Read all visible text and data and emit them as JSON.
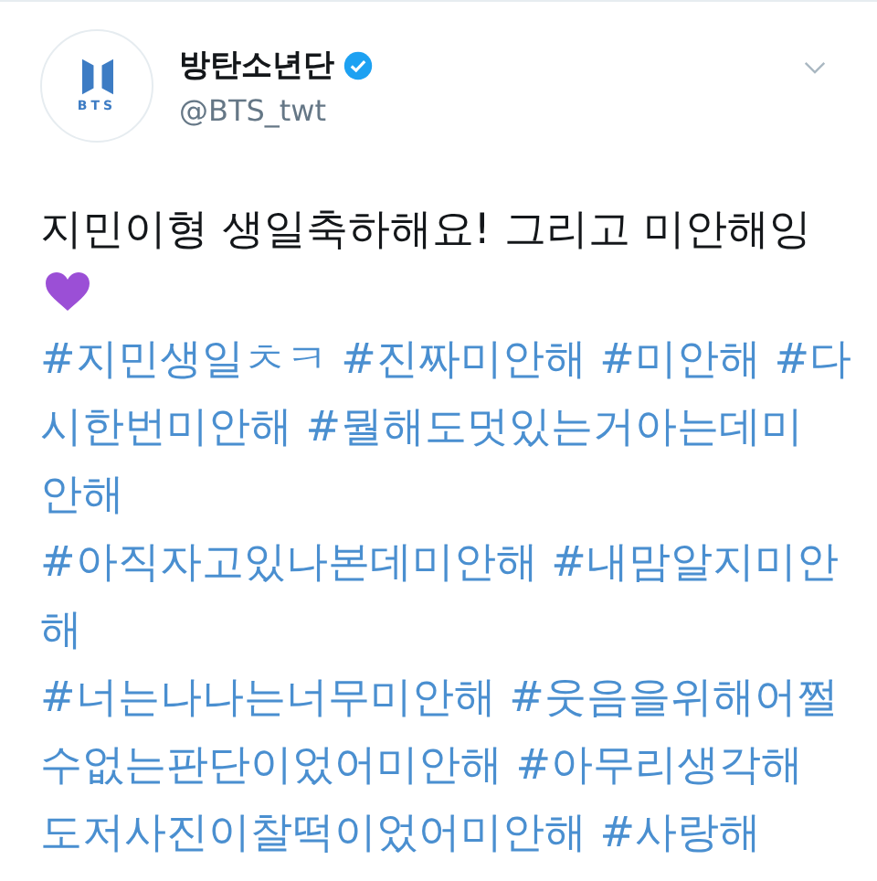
{
  "tweet": {
    "author": {
      "name": "방탄소년단",
      "verified": true,
      "handle": "@BTS_twt",
      "avatar_text": "BTS"
    },
    "text": "지민이형 생일축하해요! 그리고 미안해잉",
    "hashtag_lines": [
      "#지민생일ㅊㅋ #진짜미안해 #미안해 #다",
      "시한번미안해 #뭘해도멋있는거아는데미",
      "안해",
      "#아직자고있나본데미안해 #내맘알지미안",
      "해",
      "#너는나나는너무미안해 #웃음을위해어쩔",
      "수없는판단이었어미안해 #아무리생각해",
      "도저사진이찰떡이었어미안해 #사랑해"
    ]
  }
}
